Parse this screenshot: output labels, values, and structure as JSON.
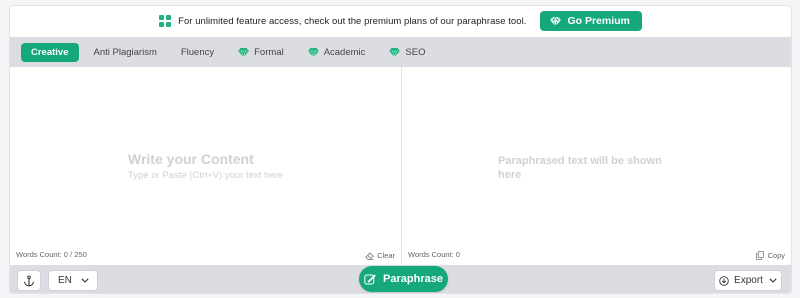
{
  "promo": {
    "text": "For unlimited feature access, check out the premium plans of our paraphrase tool.",
    "button_label": "Go Premium"
  },
  "tabs": [
    {
      "label": "Creative",
      "active": true,
      "premium": false
    },
    {
      "label": "Anti Plagiarism",
      "active": false,
      "premium": false
    },
    {
      "label": "Fluency",
      "active": false,
      "premium": false
    },
    {
      "label": "Formal",
      "active": false,
      "premium": true
    },
    {
      "label": "Academic",
      "active": false,
      "premium": true
    },
    {
      "label": "SEO",
      "active": false,
      "premium": true
    }
  ],
  "input": {
    "title": "Write your Content",
    "subtitle": "Type or Paste (Ctrl+V) your text here",
    "count": "Words Count: 0 / 250",
    "clear_label": "Clear"
  },
  "output": {
    "placeholder": "Paraphrased text will be shown here",
    "count": "Words Count: 0",
    "copy_label": "Copy"
  },
  "bottom": {
    "language": "EN",
    "paraphrase_label": "Paraphrase",
    "export_label": "Export"
  },
  "colors": {
    "accent": "#14a87a",
    "bar_bg": "#dcdde2",
    "placeholder": "#cfd1d6"
  }
}
